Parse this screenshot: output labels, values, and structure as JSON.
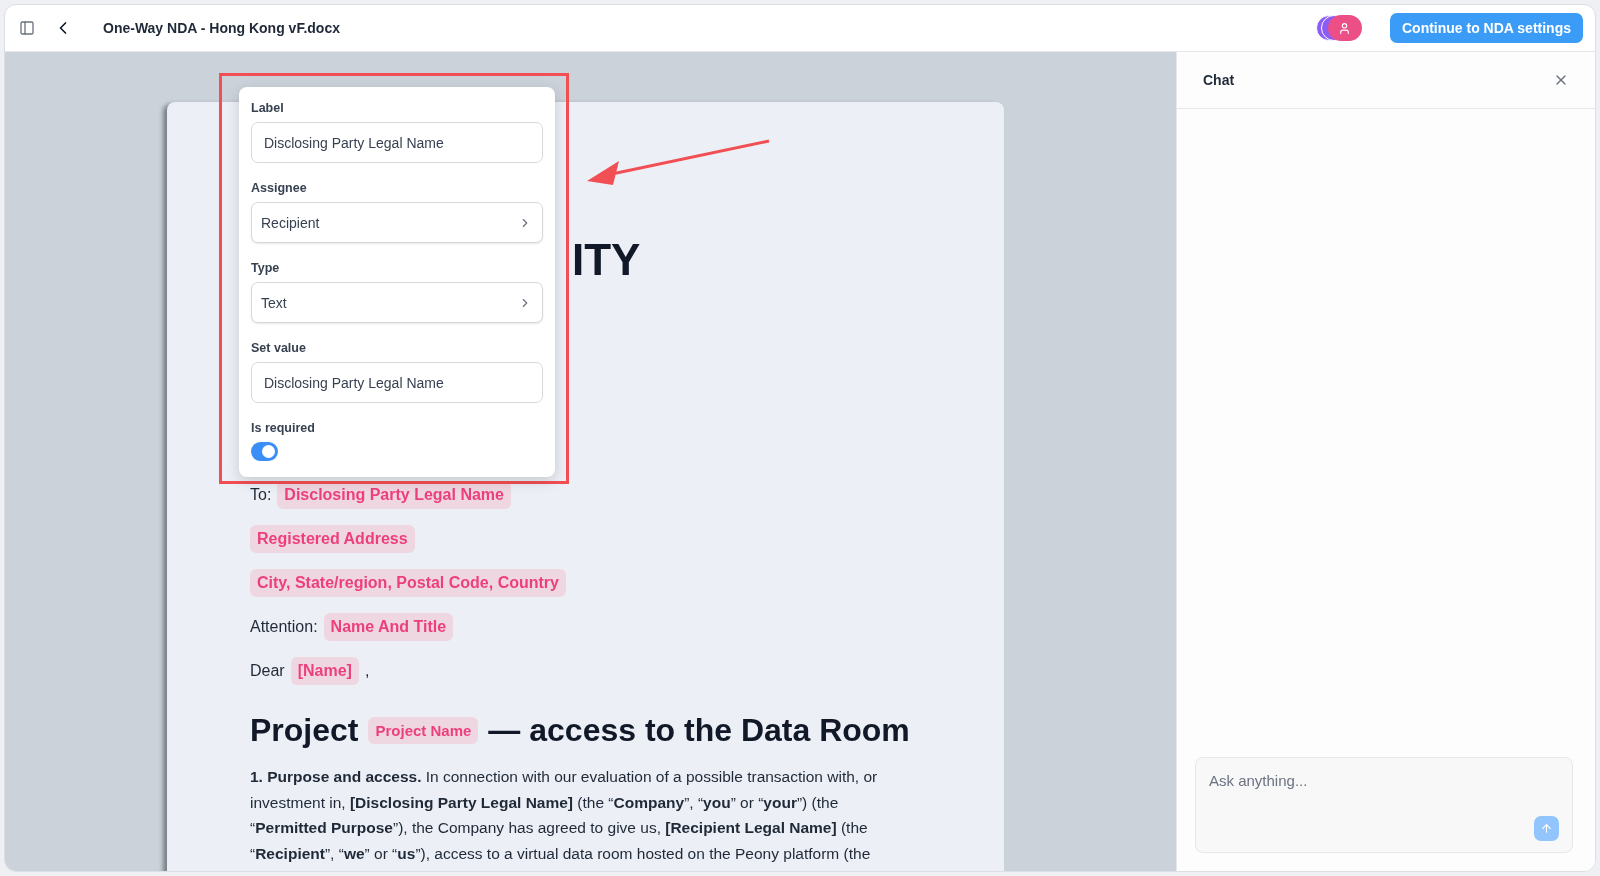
{
  "header": {
    "title": "One-Way NDA - Hong Kong vF.docx",
    "primary_button": "Continue to NDA settings"
  },
  "document": {
    "heading": "ITY",
    "lines": [
      {
        "prefix": "To:",
        "field": "Disclosing Party Legal Name"
      },
      {
        "field": "Registered Address"
      },
      {
        "field": "City, State/region, Postal Code, Country"
      },
      {
        "prefix": "Attention:",
        "field": "Name And Title"
      },
      {
        "prefix": "Dear",
        "field": "[Name]",
        "suffix": ","
      }
    ],
    "section_heading": {
      "before": "Project",
      "field": "Project Name",
      "after": "— access to the Data Room"
    },
    "paragraph": "**1. Purpose and access.** In connection with our evaluation of a possible transaction with, or investment in, **[Disclosing Party Legal Name]** (the “**Company**”, “**you**” or “**your**”) (the “**Permitted Purpose**”), the Company has agreed to give us, **[Recipient Legal Name]** (the “**Recipient**”, “**we**” or “**us**”), access to a virtual data room hosted on the Peony platform (the"
  },
  "field_editor": {
    "fields": [
      {
        "kind": "input",
        "label": "Label",
        "value": "Disclosing Party Legal Name"
      },
      {
        "kind": "select",
        "label": "Assignee",
        "value": "Recipient"
      },
      {
        "kind": "select",
        "label": "Type",
        "value": "Text"
      },
      {
        "kind": "input",
        "label": "Set value",
        "value": "Disclosing Party Legal Name"
      }
    ],
    "required": {
      "label": "Is required",
      "on": true
    }
  },
  "chat": {
    "title": "Chat",
    "input": {
      "placeholder": "Ask anything..."
    }
  }
}
